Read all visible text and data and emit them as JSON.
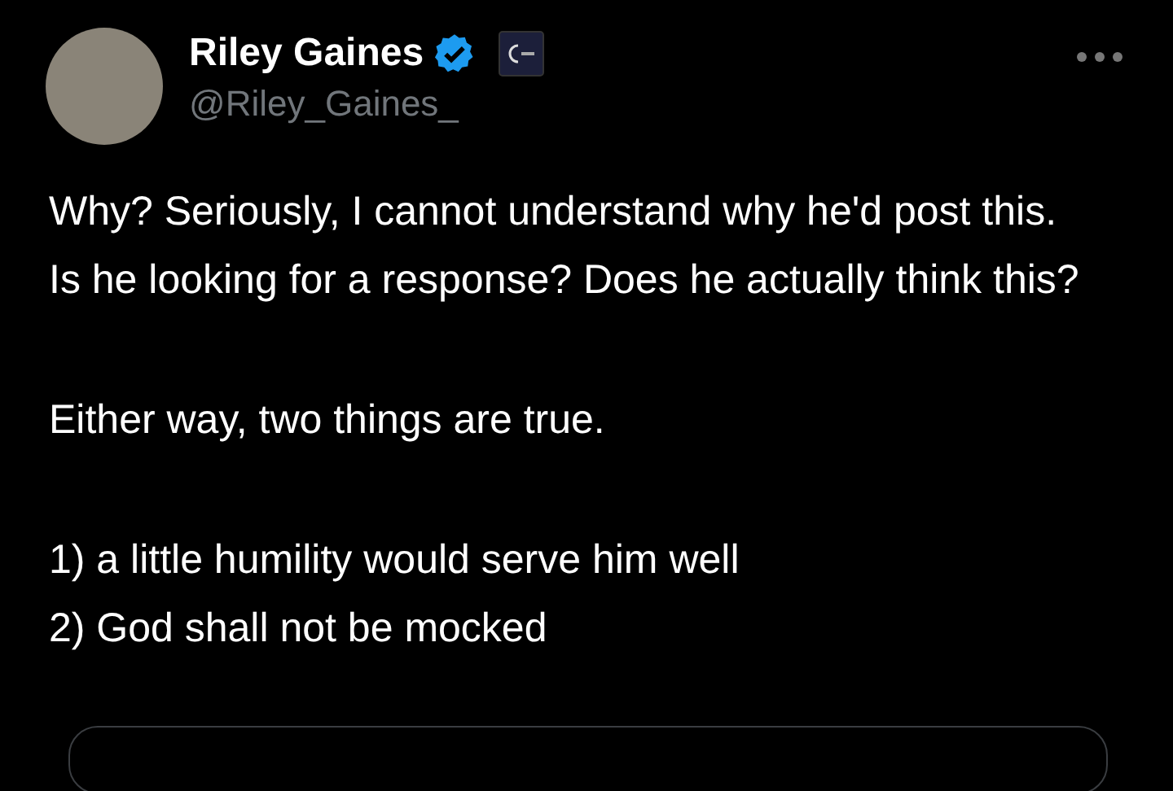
{
  "author": {
    "name": "Riley Gaines",
    "verified": true,
    "handle": "@Riley_Gaines_"
  },
  "paragraphs": [
    "Why? Seriously, I cannot understand why he'd post this. Is he looking for a response? Does he actually think this?",
    "Either way, two things are true.",
    "1) a little humility would serve him well\n2) God shall not be mocked"
  ]
}
